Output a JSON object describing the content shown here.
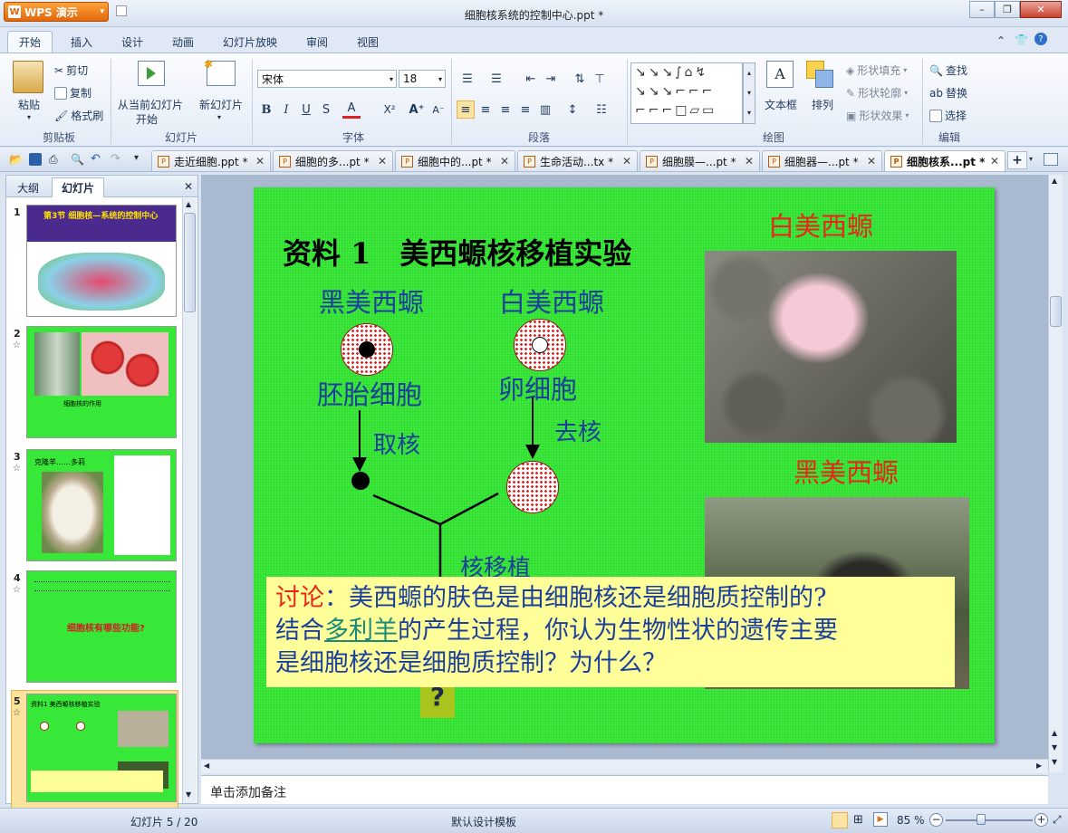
{
  "app": {
    "name": "WPS 演示",
    "document_title": "细胞核系统的控制中心.ppt *"
  },
  "ribbon_tabs": [
    "开始",
    "插入",
    "设计",
    "动画",
    "幻灯片放映",
    "审阅",
    "视图"
  ],
  "ribbon": {
    "clipboard": {
      "label": "剪贴板",
      "paste": "粘贴",
      "cut": "剪切",
      "copy": "复制",
      "format_painter": "格式刷"
    },
    "slides": {
      "label": "幻灯片",
      "from_current_line1": "从当前幻灯片",
      "from_current_line2": "开始",
      "new_slide": "新幻灯片"
    },
    "font": {
      "label": "字体",
      "font_name": "宋体",
      "font_size": "18",
      "bold": "B",
      "italic": "I",
      "underline": "U",
      "shadow": "S"
    },
    "paragraph": {
      "label": "段落"
    },
    "drawing": {
      "label": "绘图",
      "textbox": "文本框",
      "arrange": "排列",
      "shape_fill": "形状填充",
      "shape_outline": "形状轮廓",
      "shape_effect": "形状效果"
    },
    "edit": {
      "label": "编辑",
      "find": "查找",
      "replace": "替换",
      "select": "选择"
    }
  },
  "doc_tabs": [
    {
      "name": "走近细胞.ppt *"
    },
    {
      "name": "细胞的多...pt *"
    },
    {
      "name": "细胞中的...pt *"
    },
    {
      "name": "生命活动...tx *"
    },
    {
      "name": "细胞膜—...pt *"
    },
    {
      "name": "细胞器—...pt *"
    },
    {
      "name": "细胞核系...pt *"
    }
  ],
  "panel": {
    "tab_outline": "大纲",
    "tab_slides": "幻灯片"
  },
  "thumbnails": [
    {
      "num": "1",
      "text": "第3节 细胞核—系统的控制中心"
    },
    {
      "num": "2",
      "text": "细胞核的作用"
    },
    {
      "num": "3",
      "text": "克隆羊……多莉"
    },
    {
      "num": "4",
      "text": "细胞核有哪些功能?"
    },
    {
      "num": "5",
      "text": "资料1 美西螈核移植实验"
    }
  ],
  "slide": {
    "title": "资料 1　美西螈核移植实验",
    "black_axolotl": "黑美西螈",
    "white_axolotl": "白美西螈",
    "embryo_cell": "胚胎细胞",
    "egg_cell": "卵细胞",
    "take_nucleus": "取核",
    "remove_nucleus": "去核",
    "transplant": "核移植",
    "photo_label_white": "白美西螈",
    "photo_label_black": "黑美西螈",
    "question_mark": "?",
    "discussion_prefix": "讨论",
    "discussion_colon": "：",
    "discussion_line1": "美西螈的肤色是由细胞核还是细胞质控制的?",
    "discussion_link": "多利羊",
    "discussion_line2_pre": "结合",
    "discussion_line2_post": "的产生过程，你认为生物性状的遗传主要",
    "discussion_line3": "是细胞核还是细胞质控制？为什么？"
  },
  "notes_placeholder": "单击添加备注",
  "status": {
    "slide_position": "幻灯片 5 / 20",
    "template": "默认设计模板",
    "zoom": "85 %"
  },
  "colors": {
    "slide_bg": "#3cea3c",
    "title_red": "#e8261a",
    "blue_text": "#1c3f9c"
  }
}
